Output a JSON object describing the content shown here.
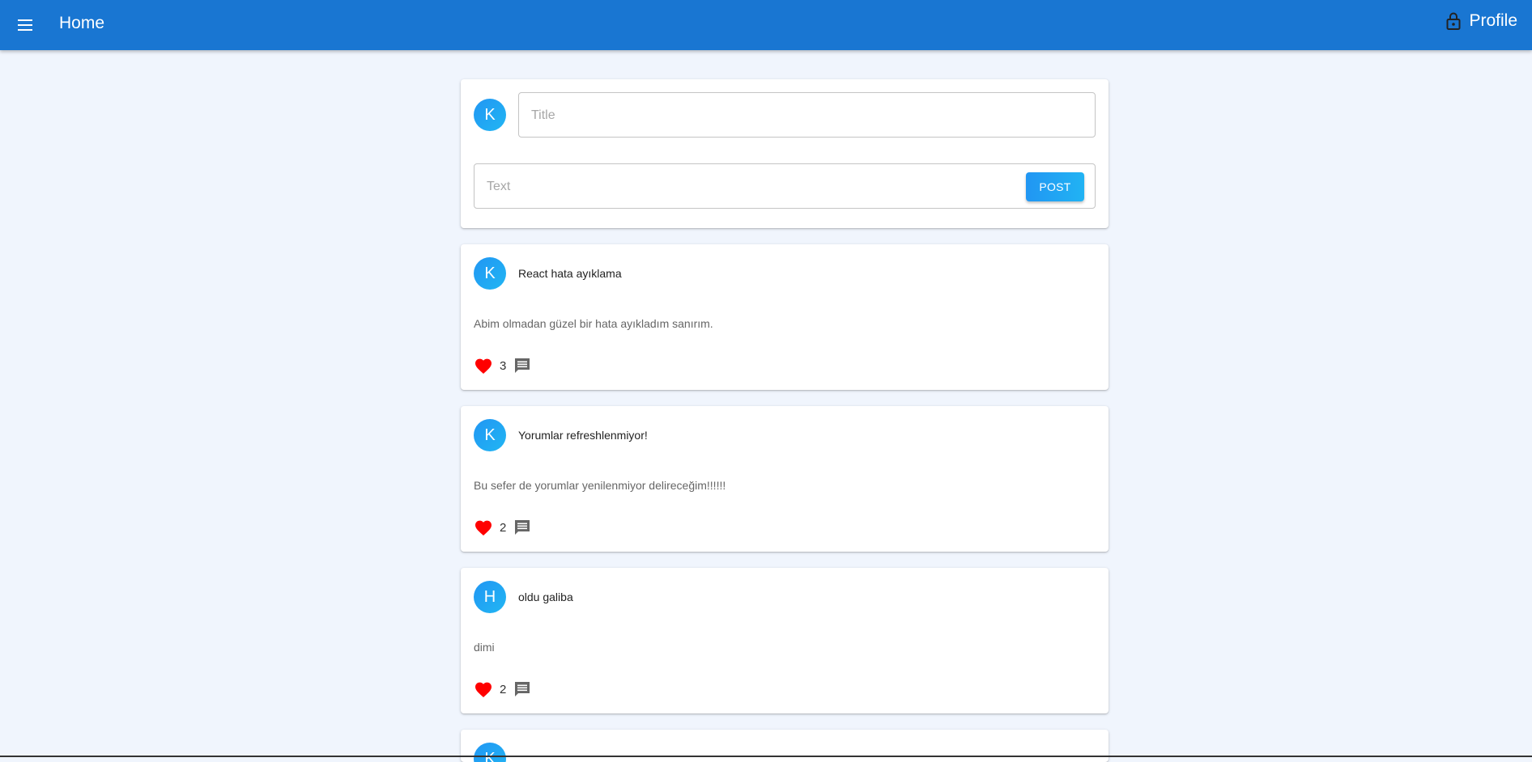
{
  "appbar": {
    "title": "Home",
    "profile_label": "Profile",
    "menu_icon": "menu-icon",
    "profile_icon": "lock-icon",
    "color": "#1976d2"
  },
  "composer": {
    "avatar_letter": "K",
    "title_placeholder": "Title",
    "title_value": "",
    "text_placeholder": "Text",
    "text_value": "",
    "post_label": "POST"
  },
  "posts": [
    {
      "avatar_letter": "K",
      "title": "React hata ayıklama",
      "text": "Abim olmadan güzel bir hata ayıkladım sanırım.",
      "likes": "3"
    },
    {
      "avatar_letter": "K",
      "title": "Yorumlar refreshlenmiyor!",
      "text": "Bu sefer de yorumlar yenilenmiyor delireceğim!!!!!!",
      "likes": "2"
    },
    {
      "avatar_letter": "H",
      "title": "oldu galiba",
      "text": "dimi",
      "likes": "2"
    },
    {
      "avatar_letter": "K"
    }
  ],
  "colors": {
    "like": "#ff0000",
    "comment_icon": "#666666",
    "avatar": "#2196f3",
    "background": "#f0f5fd"
  }
}
